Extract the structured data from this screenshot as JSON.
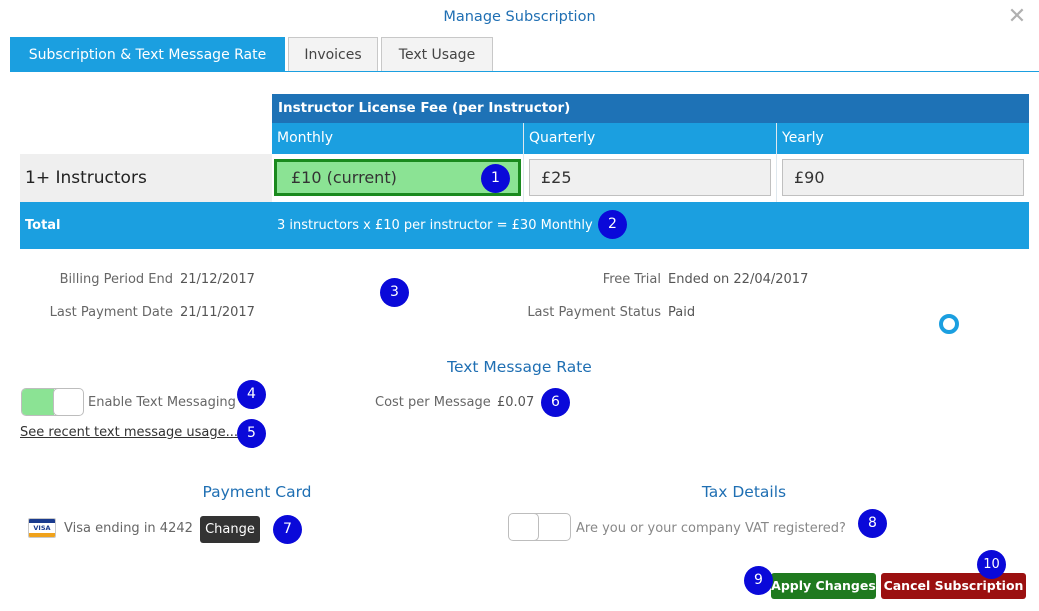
{
  "modal": {
    "title": "Manage Subscription"
  },
  "tabs": [
    {
      "label": "Subscription & Text Message Rate"
    },
    {
      "label": "Invoices"
    },
    {
      "label": "Text Usage"
    }
  ],
  "fee_table": {
    "header": "Instructor License Fee (per Instructor)",
    "periods": [
      "Monthly",
      "Quarterly",
      "Yearly"
    ],
    "row_label": "1+ Instructors",
    "prices": [
      "£10 (current)",
      "£25",
      "£90"
    ],
    "total_label": "Total",
    "total_text": "3 instructors x £10 per instructor = £30 Monthly"
  },
  "billing": {
    "period_end_label": "Billing Period End",
    "period_end_value": "21/12/2017",
    "last_payment_label": "Last Payment Date",
    "last_payment_value": "21/11/2017",
    "free_trial_label": "Free Trial",
    "free_trial_value": "Ended on 22/04/2017",
    "payment_status_label": "Last Payment Status",
    "payment_status_value": "Paid"
  },
  "text_rate": {
    "title": "Text Message Rate",
    "enable_label": "Enable Text Messaging",
    "enabled": true,
    "cost_label": "Cost per Message",
    "cost_value": "£0.07",
    "usage_link": "See recent text message usage..."
  },
  "payment_card": {
    "title": "Payment Card",
    "card_brand": "VISA",
    "card_text": "Visa ending in 4242",
    "change_label": "Change"
  },
  "tax": {
    "title": "Tax Details",
    "vat_label": "Are you or your company VAT registered?",
    "vat_registered": false
  },
  "actions": {
    "apply_label": "Apply Changes",
    "cancel_label": "Cancel Subscription"
  },
  "badges": [
    "1",
    "2",
    "3",
    "4",
    "5",
    "6",
    "7",
    "8",
    "9",
    "10"
  ],
  "colors": {
    "primary": "#1b9fe0",
    "header_dark": "#1e72b6",
    "current_green": "#8be394",
    "apply_green": "#1f7a1f",
    "cancel_red": "#9b1010",
    "badge_blue": "#0a09d9"
  }
}
